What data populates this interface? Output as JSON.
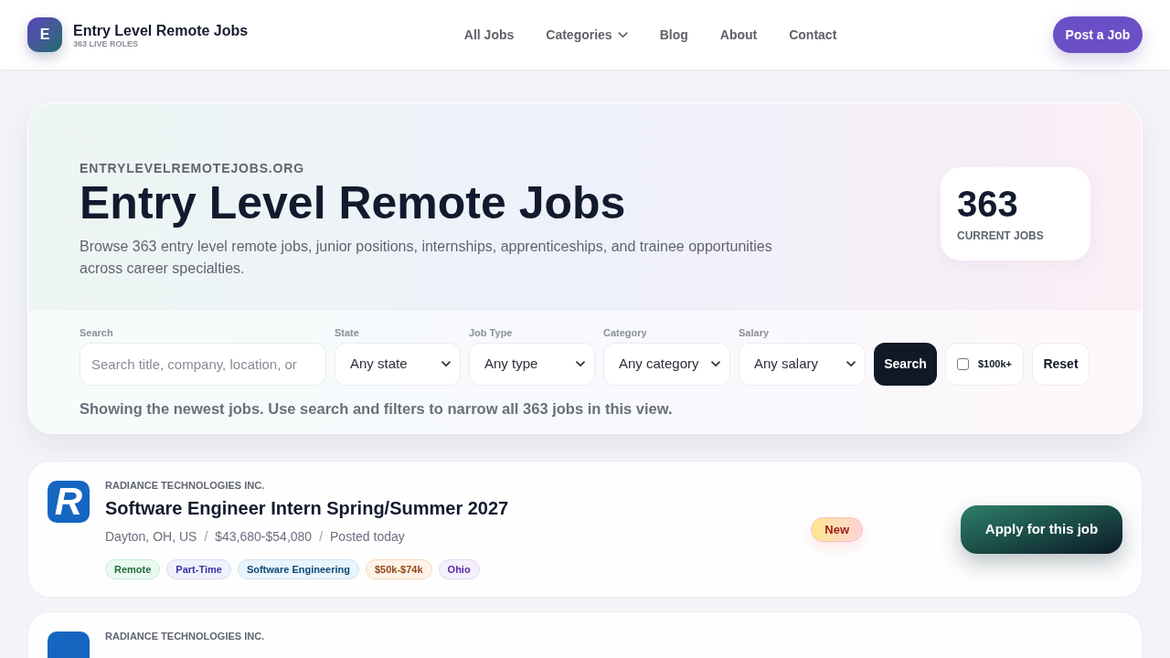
{
  "site": {
    "logo_letter": "E",
    "title": "Entry Level Remote Jobs",
    "subtitle": "363 LIVE ROLES"
  },
  "nav": [
    {
      "label": "All Jobs",
      "kind": "link"
    },
    {
      "label": "Categories",
      "kind": "dropdown"
    },
    {
      "label": "Blog",
      "kind": "link"
    },
    {
      "label": "About",
      "kind": "link"
    },
    {
      "label": "Contact",
      "kind": "link"
    }
  ],
  "post_button": "Post a Job",
  "hero": {
    "eyebrow": "ENTRYLEVELREMOTEJOBS.ORG",
    "title": "Entry Level Remote Jobs",
    "description": "Browse 363 entry level remote jobs, junior positions, internships, apprenticeships, and trainee opportunities across career specialties.",
    "stat_value": "363",
    "stat_label": "CURRENT JOBS"
  },
  "filters": {
    "fields": [
      {
        "kind": "search",
        "label": "Search",
        "placeholder": "Search title, company, location, or"
      },
      {
        "kind": "select",
        "label": "State",
        "value": "Any state"
      },
      {
        "kind": "select",
        "label": "Job Type",
        "value": "Any type"
      },
      {
        "kind": "select",
        "label": "Category",
        "value": "Any category"
      },
      {
        "kind": "select",
        "label": "Salary",
        "value": "Any salary"
      }
    ],
    "search_button": "Search",
    "high_salary": {
      "label": "$100k+",
      "checked": false
    },
    "reset_button": "Reset",
    "summary": "Showing the newest jobs. Use search and filters to narrow all 363 jobs in this view."
  },
  "jobs": [
    {
      "logo_letter": "R",
      "company": "RADIANCE TECHNOLOGIES INC.",
      "title": "Software Engineer Intern Spring/Summer 2027",
      "meta": [
        "Dayton, OH, US",
        "$43,680-$54,080",
        "Posted today"
      ],
      "meta_separator": "/",
      "tags": [
        {
          "label": "Remote",
          "kind": "remote"
        },
        {
          "label": "Part-Time",
          "kind": "type"
        },
        {
          "label": "Software Engineering",
          "kind": "category"
        },
        {
          "label": "$50k-$74k",
          "kind": "salary"
        },
        {
          "label": "Ohio",
          "kind": "location"
        }
      ],
      "badge": "New",
      "apply_label": "Apply for this job"
    },
    {
      "company": "RADIANCE TECHNOLOGIES INC."
    }
  ]
}
